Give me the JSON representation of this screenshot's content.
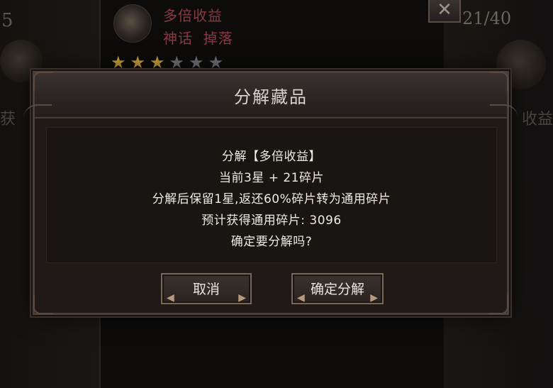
{
  "background": {
    "left_number": "5",
    "item_name": "多倍收益",
    "item_tags": "神话  掉落",
    "stars": [
      true,
      true,
      true,
      false,
      false,
      false
    ],
    "close_symbol": "✕",
    "count": "21/40",
    "right_partial": "收益",
    "left_partial": "获"
  },
  "dialog": {
    "title": "分解藏品",
    "lines": [
      "分解【多倍收益】",
      "当前3星 + 21碎片",
      "分解后保留1星,返还60%碎片转为通用碎片",
      "预计获得通用碎片: 3096",
      "确定要分解吗?"
    ],
    "cancel_label": "取消",
    "confirm_label": "确定分解"
  },
  "colors": {
    "item_name": "#8a3a40",
    "star_on": "#c9a13a",
    "star_off": "#6f7378",
    "dialog_text": "#eeeae5"
  }
}
